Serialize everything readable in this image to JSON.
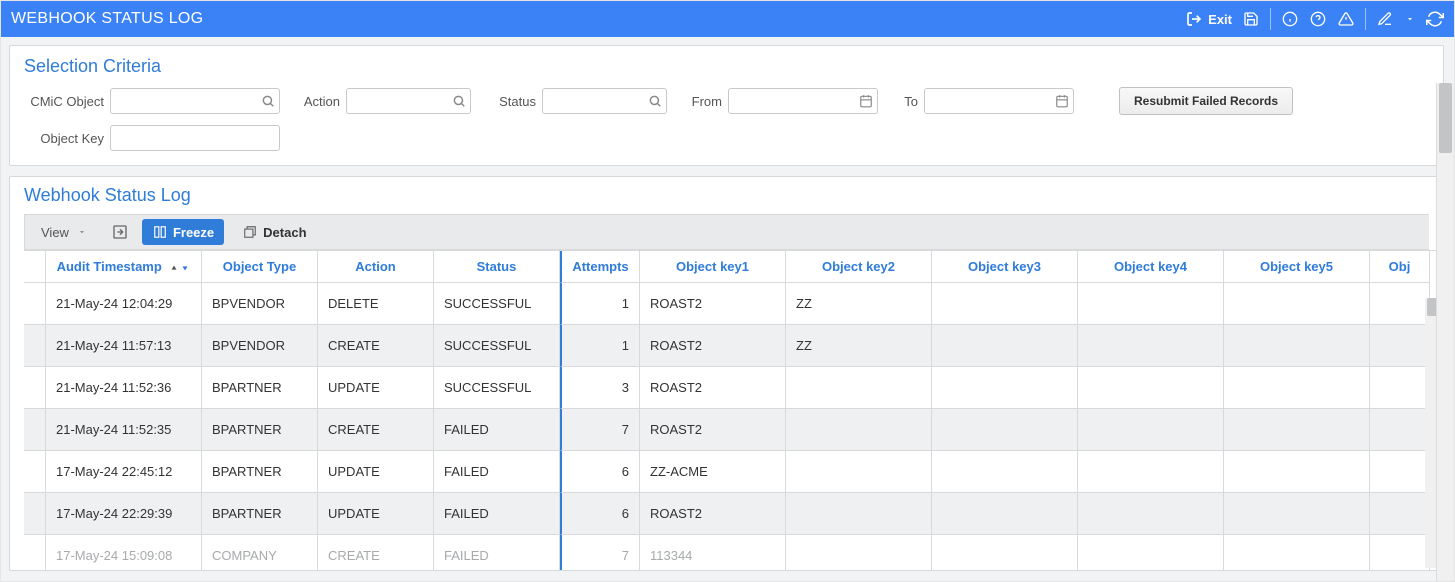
{
  "header": {
    "title": "WEBHOOK STATUS LOG",
    "exit_label": "Exit"
  },
  "selection": {
    "title": "Selection Criteria",
    "cmic_object_label": "CMiC Object",
    "cmic_object_value": "",
    "action_label": "Action",
    "action_value": "",
    "status_label": "Status",
    "status_value": "",
    "from_label": "From",
    "from_value": "",
    "to_label": "To",
    "to_value": "",
    "object_key_label": "Object Key",
    "object_key_value": "",
    "resubmit_label": "Resubmit Failed Records"
  },
  "log": {
    "title": "Webhook Status Log",
    "toolbar": {
      "view_label": "View",
      "freeze_label": "Freeze",
      "detach_label": "Detach"
    },
    "columns": {
      "audit_timestamp": "Audit Timestamp",
      "object_type": "Object Type",
      "action": "Action",
      "status": "Status",
      "attempts": "Attempts",
      "key1": "Object key1",
      "key2": "Object key2",
      "key3": "Object key3",
      "key4": "Object key4",
      "key5": "Object key5",
      "key6": "Obj"
    },
    "rows": [
      {
        "ts": "21-May-24 12:04:29",
        "type": "BPVENDOR",
        "action": "DELETE",
        "status": "SUCCESSFUL",
        "attempts": "1",
        "k1": "ROAST2",
        "k2": "ZZ",
        "k3": "",
        "k4": "",
        "k5": ""
      },
      {
        "ts": "21-May-24 11:57:13",
        "type": "BPVENDOR",
        "action": "CREATE",
        "status": "SUCCESSFUL",
        "attempts": "1",
        "k1": "ROAST2",
        "k2": "ZZ",
        "k3": "",
        "k4": "",
        "k5": ""
      },
      {
        "ts": "21-May-24 11:52:36",
        "type": "BPARTNER",
        "action": "UPDATE",
        "status": "SUCCESSFUL",
        "attempts": "3",
        "k1": "ROAST2",
        "k2": "",
        "k3": "",
        "k4": "",
        "k5": ""
      },
      {
        "ts": "21-May-24 11:52:35",
        "type": "BPARTNER",
        "action": "CREATE",
        "status": "FAILED",
        "attempts": "7",
        "k1": "ROAST2",
        "k2": "",
        "k3": "",
        "k4": "",
        "k5": ""
      },
      {
        "ts": "17-May-24 22:45:12",
        "type": "BPARTNER",
        "action": "UPDATE",
        "status": "FAILED",
        "attempts": "6",
        "k1": "ZZ-ACME",
        "k2": "",
        "k3": "",
        "k4": "",
        "k5": ""
      },
      {
        "ts": "17-May-24 22:29:39",
        "type": "BPARTNER",
        "action": "UPDATE",
        "status": "FAILED",
        "attempts": "6",
        "k1": "ROAST2",
        "k2": "",
        "k3": "",
        "k4": "",
        "k5": ""
      },
      {
        "ts": "17-May-24 15:09:08",
        "type": "COMPANY",
        "action": "CREATE",
        "status": "FAILED",
        "attempts": "7",
        "k1": "113344",
        "k2": "",
        "k3": "",
        "k4": "",
        "k5": ""
      }
    ]
  }
}
